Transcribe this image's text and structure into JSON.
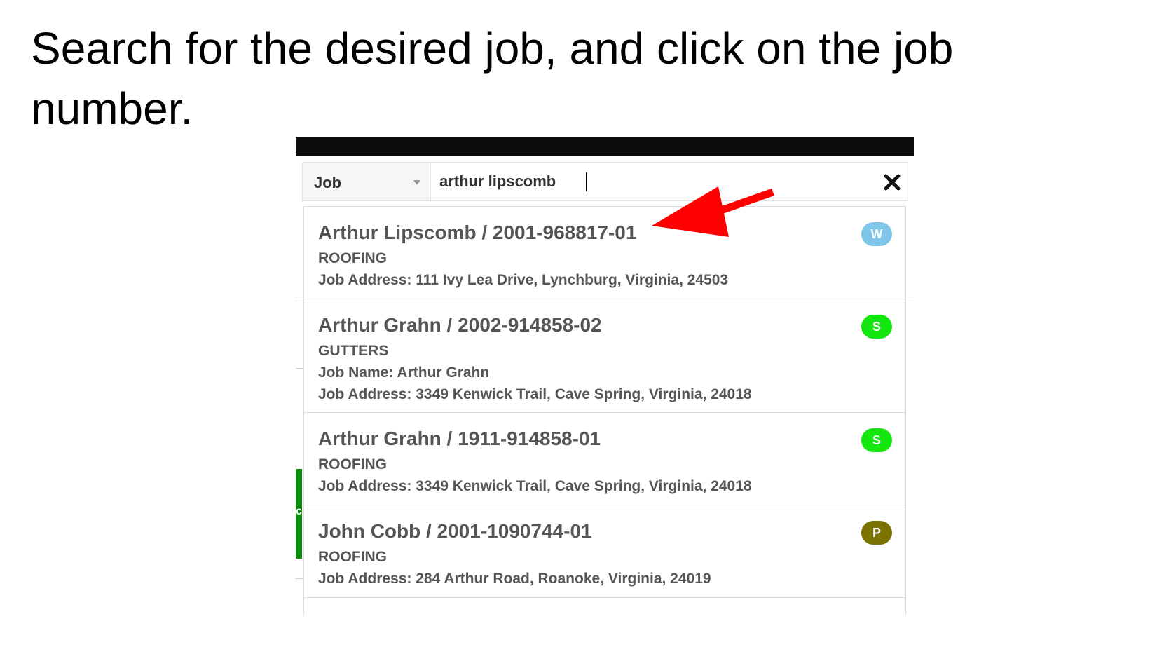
{
  "instruction": "Search for the desired job, and click on the job number.",
  "search": {
    "type_label": "Job",
    "query": "arthur lipscomb"
  },
  "results": [
    {
      "title": "Arthur Lipscomb / 2001-968817-01",
      "trade": "ROOFING",
      "job_name": null,
      "job_address": "Job Address: 111 Ivy Lea Drive, Lynchburg, Virginia, 24503",
      "badge": "W",
      "badge_color": "#7fc6e8"
    },
    {
      "title": "Arthur Grahn / 2002-914858-02",
      "trade": "GUTTERS",
      "job_name": "Job Name: Arthur Grahn",
      "job_address": "Job Address: 3349 Kenwick Trail, Cave Spring, Virginia, 24018",
      "badge": "S",
      "badge_color": "#14e60f"
    },
    {
      "title": "Arthur Grahn / 1911-914858-01",
      "trade": "ROOFING",
      "job_name": null,
      "job_address": "Job Address: 3349 Kenwick Trail, Cave Spring, Virginia, 24018",
      "badge": "S",
      "badge_color": "#14e60f"
    },
    {
      "title": "John Cobb / 2001-1090744-01",
      "trade": "ROOFING",
      "job_name": null,
      "job_address": "Job Address: 284 Arthur Road, Roanoke, Virginia, 24019",
      "badge": "P",
      "badge_color": "#7b7400"
    }
  ],
  "background_fragment": "c",
  "colors": {
    "top_bar": "#0d0d0d",
    "arrow": "#ff0000",
    "green_strip": "#0b8a0b",
    "result_text": "#555555"
  },
  "icons": {
    "dropdown": "caret-down-icon",
    "clear": "close-icon",
    "annotation": "red-arrow-icon"
  }
}
